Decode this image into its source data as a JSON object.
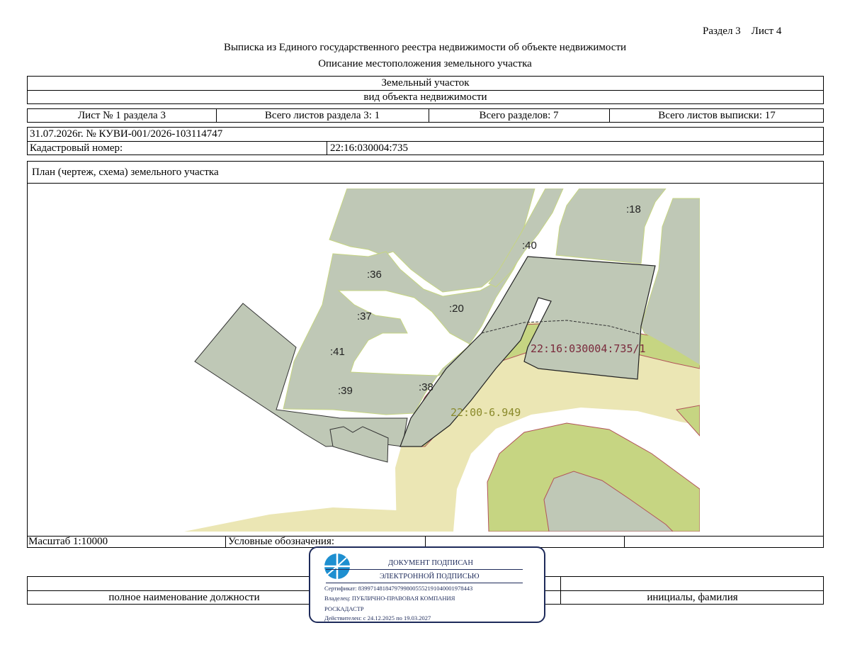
{
  "header": {
    "section_sheet": "Раздел 3    Лист 4",
    "title": "Выписка из Единого государственного реестра недвижимости об объекте недвижимости",
    "subtitle": "Описание местоположения земельного участка"
  },
  "object": {
    "name": "Земельный участок",
    "kind_caption": "вид объекта недвижимости"
  },
  "sheets": {
    "sheet_of_section": "Лист № 1 раздела 3",
    "total_section_sheets": "Всего листов раздела 3: 1",
    "total_sections": "Всего разделов: 7",
    "total_extract_sheets": "Всего листов выписки: 17"
  },
  "record": {
    "date_number": "31.07.2026г. № КУВИ-001/2026-103114747",
    "cadastral_label": "Кадастровый номер:",
    "cadastral_value": "22:16:030004:735"
  },
  "plan": {
    "title": "План (чертеж, схема) земельного участка",
    "labels": {
      "p18": ":18",
      "p40": ":40",
      "p36": ":36",
      "p20": ":20",
      "p37": ":37",
      "p41": ":41",
      "p39": ":39",
      "p38": ":38",
      "parcel": "22:16:030004:735/1",
      "zone": "22:00-6.949"
    },
    "colors": {
      "parcel_fill": "#bfc8b6",
      "light_zone": "#ebe6b4",
      "green_zone": "#c6d582",
      "parcel_label": "#7a2a3c",
      "zone_label": "#8a8a2a",
      "boundary_red": "#b2545a"
    }
  },
  "footer": {
    "scale": "Масштаб 1:10000",
    "legend": "Условные обозначения:",
    "position_caption": "полное наименование должности",
    "initials_caption": "инициалы, фамилия"
  },
  "stamp": {
    "line1": "ДОКУМЕНТ ПОДПИСАН",
    "line2": "ЭЛЕКТРОННОЙ ПОДПИСЬЮ",
    "certificate": "Сертификат: 8399714818479799800555219104000197844З",
    "owner": "Владелец: ПУБЛИЧНО-ПРАВОВАЯ КОМПАНИЯ",
    "owner2": "РОСКАДАСТР",
    "validity": "Действителен: с 24.12.2025 по 19.03.2027",
    "logo": "roskadastr-logo-icon",
    "color": "#1d2a5a"
  }
}
